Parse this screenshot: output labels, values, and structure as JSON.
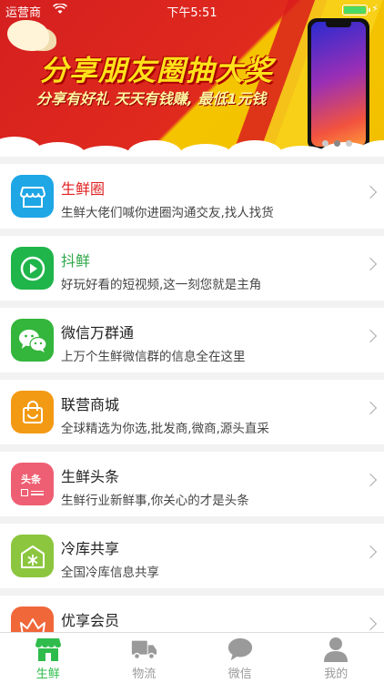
{
  "status_bar": {
    "carrier": "运营商",
    "time": "下午5:51"
  },
  "banner": {
    "headline": "分享朋友圈抽大奖",
    "subline": "分享有好礼  天天有钱赚, 最低1元钱",
    "page_count": 3,
    "active_page": 2
  },
  "colors": {
    "brand_green": "#2fbc4c",
    "inactive_gray": "#9a9a9a"
  },
  "items": [
    {
      "title": "生鲜圈",
      "desc": "生鲜大佬们喊你进圈沟通交友,找人找货",
      "icon": "store-icon",
      "icon_color": "#1ea6e5",
      "title_color": "#e02020"
    },
    {
      "title": "抖鲜",
      "desc": "好玩好看的短视频,这一刻您就是主角",
      "icon": "play-icon",
      "icon_color": "#1fb54a",
      "title_color": "#2fa84a"
    },
    {
      "title": "微信万群通",
      "desc": "上万个生鲜微信群的信息全在这里",
      "icon": "wechat-icon",
      "icon_color": "#34b53c",
      "title_color": "#222222"
    },
    {
      "title": "联营商城",
      "desc": "全球精选为你选,批发商,微商,源头直采",
      "icon": "shopping-bag-icon",
      "icon_color": "#f39a14",
      "title_color": "#222222"
    },
    {
      "title": "生鲜头条",
      "desc": "生鲜行业新鲜事,你关心的才是头条",
      "icon": "headline-icon",
      "icon_color": "#ee5f73",
      "icon_text": "头条",
      "title_color": "#222222"
    },
    {
      "title": "冷库共享",
      "desc": "全国冷库信息共享",
      "icon": "cold-storage-icon",
      "icon_color": "#8cc63f",
      "title_color": "#222222"
    },
    {
      "title": "优享会员",
      "desc": "",
      "icon": "crown-icon",
      "icon_color": "#f0673a",
      "title_color": "#222222"
    }
  ],
  "tabs": [
    {
      "label": "生鲜",
      "icon": "store-icon",
      "active": true
    },
    {
      "label": "物流",
      "icon": "truck-icon",
      "active": false
    },
    {
      "label": "微信",
      "icon": "chat-bubble-icon",
      "active": false
    },
    {
      "label": "我的",
      "icon": "person-icon",
      "active": false
    }
  ]
}
